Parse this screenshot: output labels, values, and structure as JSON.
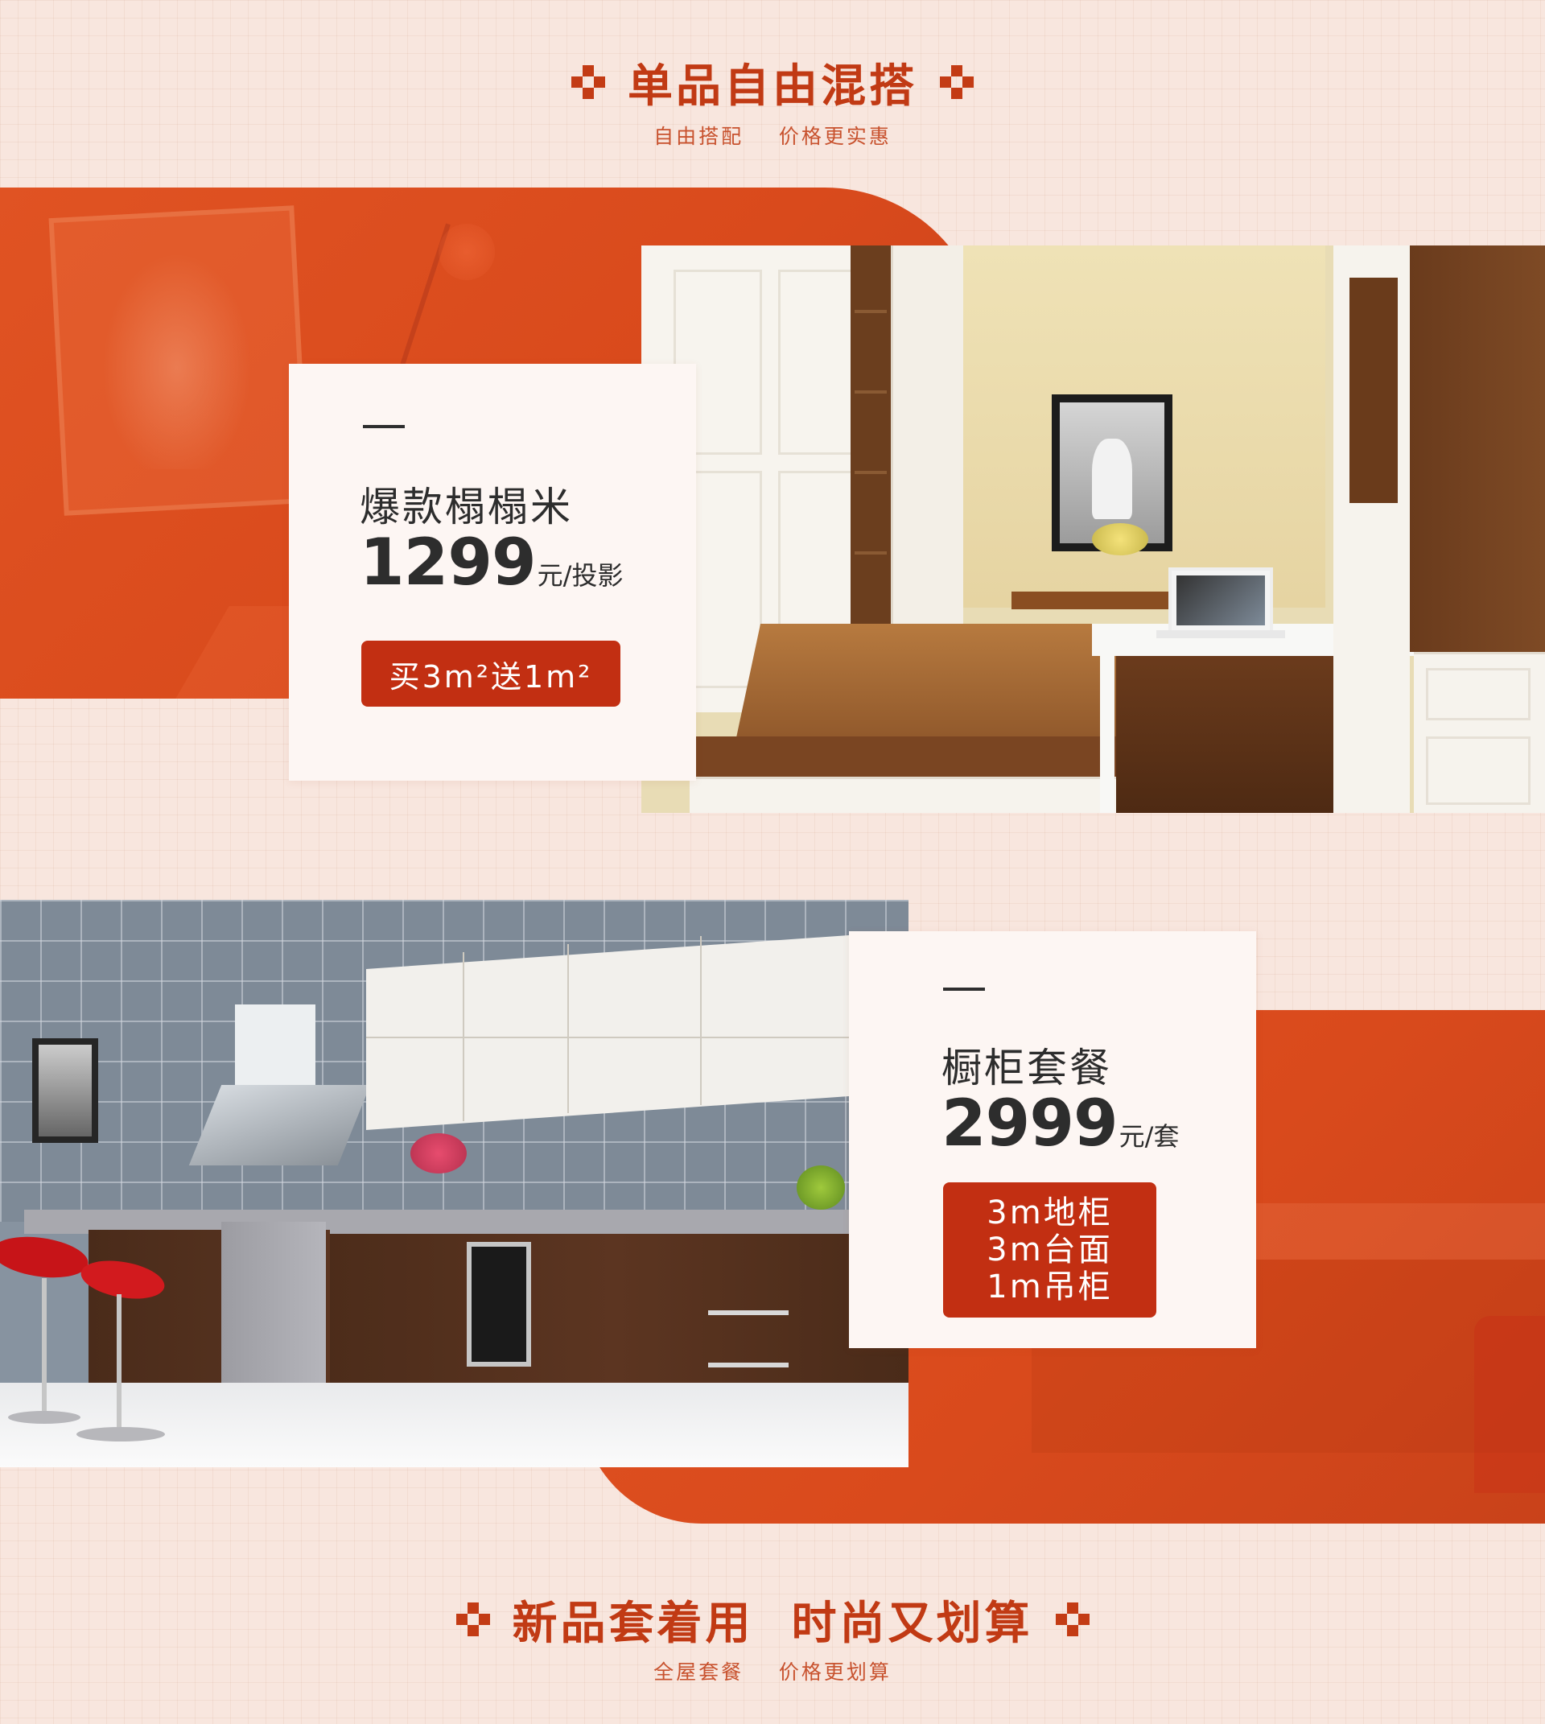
{
  "section1": {
    "title": "单品自由混搭",
    "subtitle": "自由搭配    价格更实惠"
  },
  "product1": {
    "name": "爆款榻榻米",
    "price": "1299",
    "unit": "元/投影",
    "promo": "买3m²送1m²"
  },
  "product2": {
    "name": "橱柜套餐",
    "price": "2999",
    "unit": "元/套",
    "promo_lines": [
      "3m地柜",
      "3m台面",
      "1m吊柜"
    ]
  },
  "section2": {
    "title": "新品套着用  时尚又划算",
    "subtitle": "全屋套餐    价格更划算"
  },
  "colors": {
    "accent": "#c13a14",
    "panel_orange": "#dc4e1f",
    "promo_red": "#c22f12",
    "background": "#f8e6de"
  },
  "icons": [
    "pixel-bracket-left-icon",
    "pixel-bracket-right-icon"
  ]
}
